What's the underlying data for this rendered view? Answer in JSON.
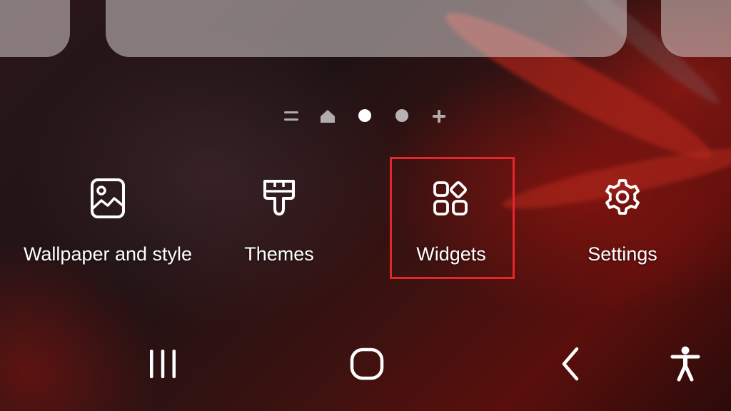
{
  "colors": {
    "highlight": "#e5262b",
    "text": "#ffffff",
    "card": "#d7cdcd",
    "indicator_active": "#ffffff",
    "indicator_inactive": "#b7b3b3"
  },
  "page_indicator": {
    "items": [
      {
        "icon": "menu-icon"
      },
      {
        "icon": "home-icon"
      },
      {
        "icon": "dot-active"
      },
      {
        "icon": "dot-inactive"
      },
      {
        "icon": "plus-icon"
      }
    ]
  },
  "options": [
    {
      "label": "Wallpaper and style",
      "icon": "wallpaper-icon"
    },
    {
      "label": "Themes",
      "icon": "paintbrush-icon"
    },
    {
      "label": "Widgets",
      "icon": "widgets-icon",
      "highlighted": true
    },
    {
      "label": "Settings",
      "icon": "gear-icon"
    }
  ],
  "nav_bar": {
    "buttons": [
      {
        "icon": "recents-icon"
      },
      {
        "icon": "home-icon"
      },
      {
        "icon": "back-icon"
      },
      {
        "icon": "accessibility-icon"
      }
    ]
  }
}
